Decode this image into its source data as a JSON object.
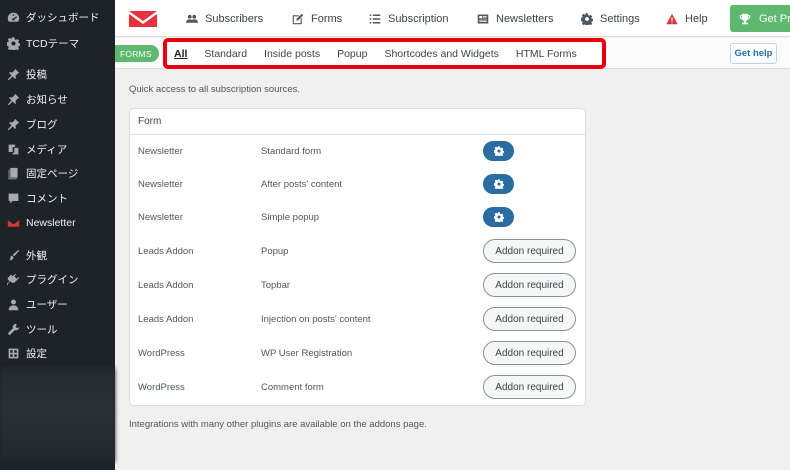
{
  "sidebar": {
    "items": [
      {
        "label": "ダッシュボード",
        "icon": "dashboard-icon"
      },
      {
        "label": "TCDテーマ",
        "icon": "gear-icon"
      },
      {
        "label": "投稿",
        "icon": "pin-icon"
      },
      {
        "label": "お知らせ",
        "icon": "pin-icon"
      },
      {
        "label": "ブログ",
        "icon": "pin-icon"
      },
      {
        "label": "メディア",
        "icon": "media-icon"
      },
      {
        "label": "固定ページ",
        "icon": "page-icon"
      },
      {
        "label": "コメント",
        "icon": "comment-icon"
      },
      {
        "label": "Newsletter",
        "icon": "newsletter-icon"
      },
      {
        "label": "外観",
        "icon": "brush-icon"
      },
      {
        "label": "プラグイン",
        "icon": "plugin-icon"
      },
      {
        "label": "ユーザー",
        "icon": "user-icon"
      },
      {
        "label": "ツール",
        "icon": "wrench-icon"
      },
      {
        "label": "設定",
        "icon": "settings-icon"
      }
    ]
  },
  "topnav": {
    "items": [
      {
        "label": "Subscribers",
        "icon": "users-icon"
      },
      {
        "label": "Forms",
        "icon": "edit-icon"
      },
      {
        "label": "Subscription",
        "icon": "list-icon"
      },
      {
        "label": "Newsletters",
        "icon": "newspaper-icon"
      },
      {
        "label": "Settings",
        "icon": "cog-icon"
      },
      {
        "label": "Help",
        "icon": "warning-icon"
      }
    ],
    "get_pro": "Get Pro",
    "accent_color": "#5fb86f"
  },
  "subnav": {
    "badge": "FORMS",
    "tabs": [
      "All",
      "Standard",
      "Inside posts",
      "Popup",
      "Shortcodes and Widgets",
      "HTML Forms"
    ],
    "active_tab": "All",
    "get_help": "Get help",
    "highlight_color": "#e8000c"
  },
  "main": {
    "intro": "Quick access to all subscription sources.",
    "table_header": "Form",
    "rows": [
      {
        "source": "Newsletter",
        "name": "Standard form",
        "action": "gear"
      },
      {
        "source": "Newsletter",
        "name": "After posts' content",
        "action": "gear"
      },
      {
        "source": "Newsletter",
        "name": "Simple popup",
        "action": "gear"
      },
      {
        "source": "Leads Addon",
        "name": "Popup",
        "action": "Addon required"
      },
      {
        "source": "Leads Addon",
        "name": "Topbar",
        "action": "Addon required"
      },
      {
        "source": "Leads Addon",
        "name": "Injection on posts' content",
        "action": "Addon required"
      },
      {
        "source": "WordPress",
        "name": "WP User Registration",
        "action": "Addon required"
      },
      {
        "source": "WordPress",
        "name": "Comment form",
        "action": "Addon required"
      }
    ],
    "footer_note": "Integrations with many other plugins are available on the addons page."
  }
}
